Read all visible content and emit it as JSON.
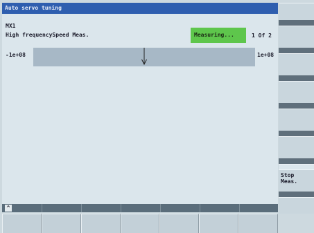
{
  "title": "Auto servo tuning",
  "axis": "MX1",
  "measurement": "High frequencySpeed Meas.",
  "status": "Measuring...",
  "step": "1 Of 2",
  "range": {
    "min": "-1e+08",
    "max": "1e+08",
    "pointer_fraction": 0.5
  },
  "scroll_arrow": "^",
  "vertical_softkeys": [
    "",
    "",
    "",
    "",
    "",
    "",
    "",
    "Stop\nMeas."
  ],
  "horizontal_softkeys": [
    "",
    "",
    "",
    "",
    "",
    "",
    ""
  ],
  "colors": {
    "title_bar": "#2e5eaf",
    "status_bg": "#5ec64c",
    "bar": "#a7b8c6"
  }
}
